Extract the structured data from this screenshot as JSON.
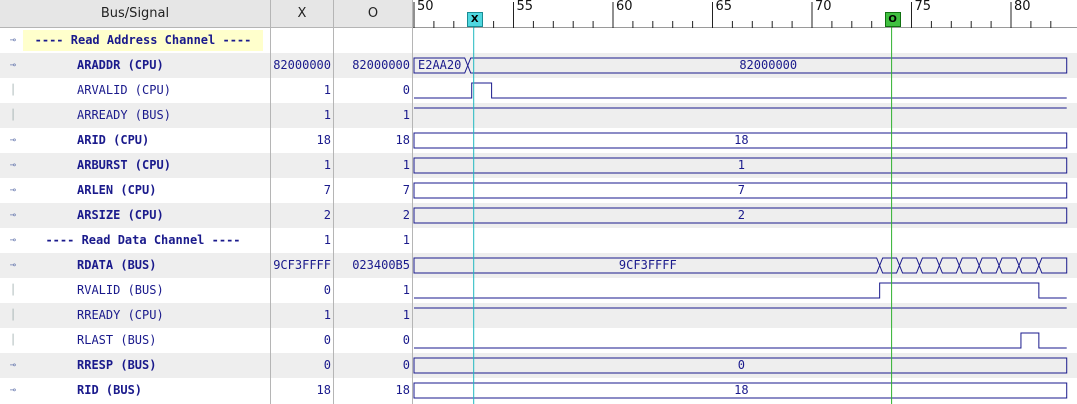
{
  "headers": {
    "names": "Bus/Signal",
    "x": "X",
    "o": "O"
  },
  "timeline": {
    "ticks": [
      50,
      55,
      60,
      65,
      70,
      75,
      80
    ],
    "t_start": 50,
    "t_end": 82.8,
    "cursor_x": {
      "label": "X",
      "time": 53.0
    },
    "cursor_o": {
      "label": "O",
      "time": 74.0
    }
  },
  "colors": {
    "wave": "#1a1a8c",
    "cursor_x": "#1fb8c0",
    "cursor_o": "#30b030"
  },
  "signals": [
    {
      "name": "---- Read Address Channel ----",
      "kind": "group",
      "highlight": true,
      "x": "",
      "o": ""
    },
    {
      "name": "ARADDR (CPU)",
      "kind": "bus",
      "bold": true,
      "x": "82000000",
      "o": "82000000",
      "segments": [
        {
          "t0": 50,
          "t1": 52.7,
          "label": "E2AA20"
        },
        {
          "t0": 52.7,
          "t1": 82.8,
          "label": "82000000"
        }
      ]
    },
    {
      "name": "ARVALID (CPU)",
      "kind": "bit",
      "bold": false,
      "x": "1",
      "o": "0",
      "levels": [
        {
          "t0": 50,
          "t1": 52.9,
          "v": 0
        },
        {
          "t0": 52.9,
          "t1": 53.9,
          "v": 1
        },
        {
          "t0": 53.9,
          "t1": 82.8,
          "v": 0
        }
      ]
    },
    {
      "name": "ARREADY (BUS)",
      "kind": "bit",
      "bold": false,
      "x": "1",
      "o": "1",
      "levels": [
        {
          "t0": 50,
          "t1": 82.8,
          "v": 1
        }
      ]
    },
    {
      "name": "ARID (CPU)",
      "kind": "bus",
      "bold": true,
      "x": "18",
      "o": "18",
      "segments": [
        {
          "t0": 50,
          "t1": 82.8,
          "label": "18"
        }
      ]
    },
    {
      "name": "ARBURST (CPU)",
      "kind": "bus",
      "bold": true,
      "x": "1",
      "o": "1",
      "segments": [
        {
          "t0": 50,
          "t1": 82.8,
          "label": "1"
        }
      ]
    },
    {
      "name": "ARLEN (CPU)",
      "kind": "bus",
      "bold": true,
      "x": "7",
      "o": "7",
      "segments": [
        {
          "t0": 50,
          "t1": 82.8,
          "label": "7"
        }
      ]
    },
    {
      "name": "ARSIZE (CPU)",
      "kind": "bus",
      "bold": true,
      "x": "2",
      "o": "2",
      "segments": [
        {
          "t0": 50,
          "t1": 82.8,
          "label": "2"
        }
      ]
    },
    {
      "name": "---- Read Data Channel ----",
      "kind": "group",
      "highlight": false,
      "x": "1",
      "o": "1"
    },
    {
      "name": "RDATA (BUS)",
      "kind": "bus",
      "bold": true,
      "x": "9CF3FFFF",
      "o": "023400B5",
      "segments": [
        {
          "t0": 50,
          "t1": 73.4,
          "label": "9CF3FFFF"
        },
        {
          "t0": 73.4,
          "t1": 74.4,
          "label": ""
        },
        {
          "t0": 74.4,
          "t1": 75.4,
          "label": ""
        },
        {
          "t0": 75.4,
          "t1": 76.4,
          "label": ""
        },
        {
          "t0": 76.4,
          "t1": 77.4,
          "label": ""
        },
        {
          "t0": 77.4,
          "t1": 78.4,
          "label": ""
        },
        {
          "t0": 78.4,
          "t1": 79.4,
          "label": ""
        },
        {
          "t0": 79.4,
          "t1": 80.4,
          "label": ""
        },
        {
          "t0": 80.4,
          "t1": 81.4,
          "label": ""
        },
        {
          "t0": 81.4,
          "t1": 82.8,
          "label": ""
        }
      ]
    },
    {
      "name": "RVALID (BUS)",
      "kind": "bit",
      "bold": false,
      "x": "0",
      "o": "1",
      "levels": [
        {
          "t0": 50,
          "t1": 73.4,
          "v": 0
        },
        {
          "t0": 73.4,
          "t1": 81.4,
          "v": 1
        },
        {
          "t0": 81.4,
          "t1": 82.8,
          "v": 0
        }
      ]
    },
    {
      "name": "RREADY (CPU)",
      "kind": "bit",
      "bold": false,
      "x": "1",
      "o": "1",
      "levels": [
        {
          "t0": 50,
          "t1": 82.8,
          "v": 1
        }
      ]
    },
    {
      "name": "RLAST (BUS)",
      "kind": "bit",
      "bold": false,
      "x": "0",
      "o": "0",
      "levels": [
        {
          "t0": 50,
          "t1": 80.5,
          "v": 0
        },
        {
          "t0": 80.5,
          "t1": 81.4,
          "v": 1
        },
        {
          "t0": 81.4,
          "t1": 82.8,
          "v": 0
        }
      ]
    },
    {
      "name": "RRESP (BUS)",
      "kind": "bus",
      "bold": true,
      "x": "0",
      "o": "0",
      "segments": [
        {
          "t0": 50,
          "t1": 82.8,
          "label": "0"
        }
      ]
    },
    {
      "name": "RID (BUS)",
      "kind": "bus",
      "bold": true,
      "x": "18",
      "o": "18",
      "segments": [
        {
          "t0": 50,
          "t1": 82.8,
          "label": "18"
        }
      ]
    }
  ]
}
